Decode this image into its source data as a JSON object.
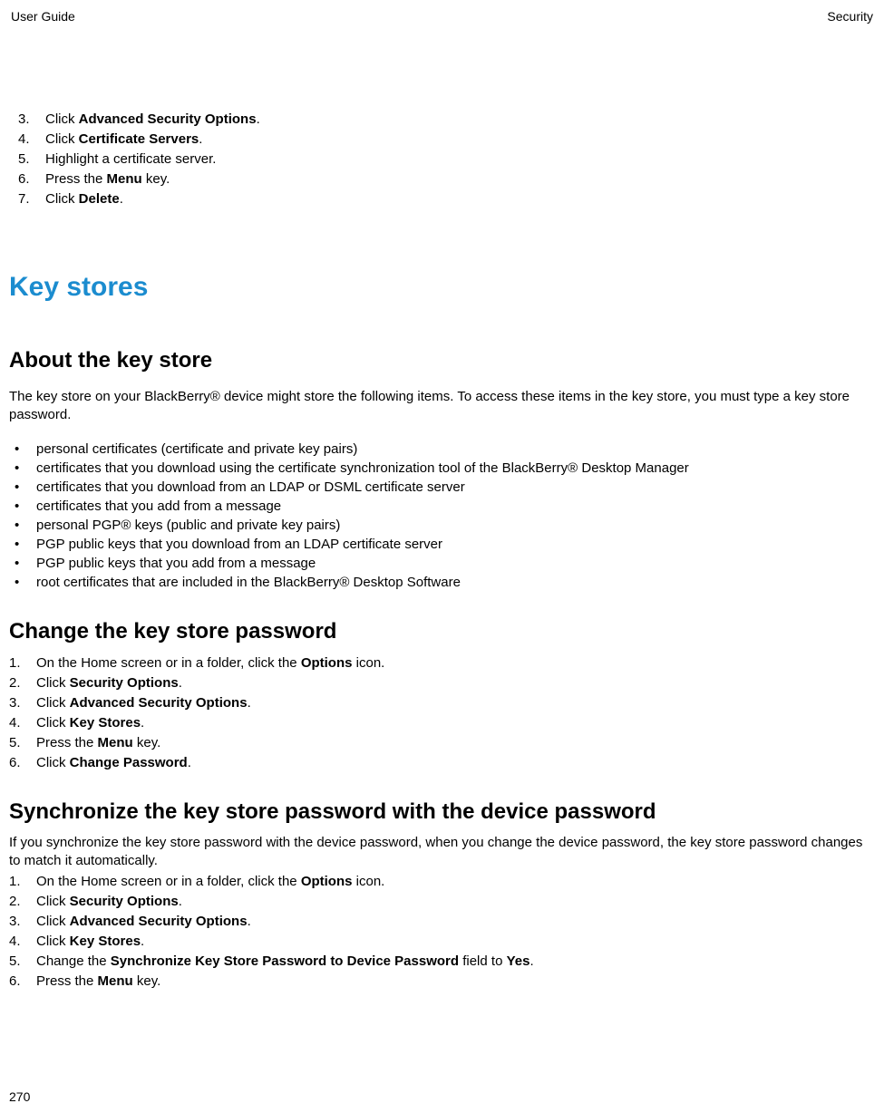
{
  "header": {
    "left": "User Guide",
    "right": "Security"
  },
  "topList": {
    "items": [
      {
        "num": "3.",
        "pre": "Click ",
        "bold": "Advanced Security Options",
        "post": "."
      },
      {
        "num": "4.",
        "pre": "Click ",
        "bold": "Certificate Servers",
        "post": "."
      },
      {
        "num": "5.",
        "pre": "Highlight a certificate server.",
        "bold": "",
        "post": ""
      },
      {
        "num": "6.",
        "pre": "Press the ",
        "bold": "Menu",
        "post": " key."
      },
      {
        "num": "7.",
        "pre": "Click ",
        "bold": "Delete",
        "post": "."
      }
    ]
  },
  "h1": "Key stores",
  "h2a": "About the key store",
  "intro": "The key store on your BlackBerry® device might store the following items. To access these items in the key store, you must type a key store password.",
  "bullets": [
    "personal certificates (certificate and private key pairs)",
    "certificates that you download using the certificate synchronization tool of the BlackBerry® Desktop Manager",
    "certificates that you download from an LDAP or DSML certificate server",
    "certificates that you add from a message",
    "personal PGP® keys (public and private key pairs)",
    "PGP public keys that you download from an LDAP certificate server",
    "PGP public keys that you add from a message",
    "root certificates that are included in the BlackBerry® Desktop Software"
  ],
  "h2b": "Change the key store password",
  "changeList": [
    {
      "num": "1.",
      "pre": "On the Home screen or in a folder, click the ",
      "bold": "Options",
      "post": " icon."
    },
    {
      "num": "2.",
      "pre": "Click ",
      "bold": "Security Options",
      "post": "."
    },
    {
      "num": "3.",
      "pre": "Click ",
      "bold": "Advanced Security Options",
      "post": "."
    },
    {
      "num": "4.",
      "pre": "Click ",
      "bold": "Key Stores",
      "post": "."
    },
    {
      "num": "5.",
      "pre": "Press the ",
      "bold": "Menu",
      "post": " key."
    },
    {
      "num": "6.",
      "pre": "Click ",
      "bold": "Change Password",
      "post": "."
    }
  ],
  "h2c": "Synchronize the key store password with the device password",
  "syncIntro": "If you synchronize the key store password with the device password, when you change the device password, the key store password changes to match it automatically.",
  "syncList": [
    {
      "num": "1.",
      "pre": "On the Home screen or in a folder, click the ",
      "bold": "Options",
      "post": " icon."
    },
    {
      "num": "2.",
      "pre": "Click ",
      "bold": "Security Options",
      "post": "."
    },
    {
      "num": "3.",
      "pre": "Click ",
      "bold": "Advanced Security Options",
      "post": "."
    },
    {
      "num": "4.",
      "pre": "Click ",
      "bold": "Key Stores",
      "post": "."
    },
    {
      "num": "5.",
      "pre": "Change the ",
      "bold": "Synchronize Key Store Password to Device Password",
      "post": " field to ",
      "bold2": "Yes",
      "post2": "."
    },
    {
      "num": "6.",
      "pre": "Press the ",
      "bold": "Menu",
      "post": " key."
    }
  ],
  "pageNum": "270"
}
